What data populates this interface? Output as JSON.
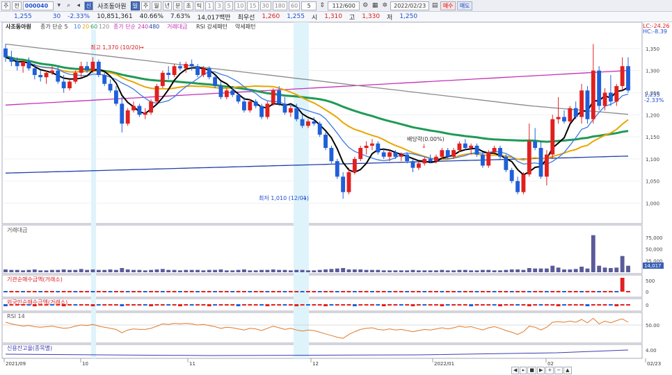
{
  "toolbar": {
    "main_menu": "주",
    "jeon": "전",
    "code": "000040",
    "name": "사조동아원",
    "credit_badge": "신",
    "chart_badge": "일",
    "periods": [
      "주",
      "월",
      "년",
      "분",
      "초",
      "틱"
    ],
    "minutes": [
      "1",
      "3",
      "5",
      "10",
      "15",
      "30",
      "180",
      "60"
    ],
    "interval": "5",
    "count": "112/600",
    "date": "2022/02/23",
    "buy_label": "매수",
    "sell_label": "매도"
  },
  "quote": {
    "price": "1,255",
    "change": "30",
    "change_pct": "-2.33%",
    "volume": "10,851,361",
    "vol_ratio": "40.66%",
    "turnover": "7.63%",
    "amount": "14,017백만",
    "best_label": "최우선",
    "best_price": "1,260",
    "best_price2": "1,255",
    "open_label": "시",
    "open": "1,310",
    "high_label": "고",
    "high": "1,330",
    "low_label": "저",
    "low": "1,250"
  },
  "legend": {
    "name": "사조동아원",
    "ma_label": "종가 단순 5",
    "ma_periods": [
      "10",
      "20",
      "60",
      "120"
    ],
    "ma2_label": "종가 단순",
    "ma2_periods": [
      "240",
      "480"
    ],
    "vol_label": "거래대금",
    "rsi_label": "RSI 강세패턴",
    "weak_label": "약세패턴",
    "lc": "LC:-24.26",
    "hc": "HC:-8.39"
  },
  "annotations": {
    "high_note": "최고 1,370 (10/20)",
    "low_note": "최저 1,010 (12/01)",
    "dividend": "배당락(0.00%)",
    "price_tag": "1,255",
    "price_tag_pct": "-2.33%",
    "vol_tag": "14,017"
  },
  "panels": {
    "volume": "거래대금",
    "inst": "기관순매수금액(거래소)",
    "foreign": "외국인순매수금액(거래소)",
    "rsi": "RSI 14",
    "credit": "신용잔고율(종목별)"
  },
  "axes": {
    "price_ticks": [
      "1,350",
      "1,300",
      "1,250",
      "1,200",
      "1,150",
      "1,100",
      "1,050",
      "1,000"
    ],
    "vol_ticks": [
      "75,000",
      "50,000",
      "25,000"
    ],
    "inst_ticks": [
      "500",
      "0"
    ],
    "foreign_ticks": [
      "0"
    ],
    "rsi_ticks": [
      "50.00"
    ],
    "credit_ticks": [
      "4.00"
    ],
    "date_ticks": [
      "2021/09",
      "10",
      "11",
      "12",
      "2022/01",
      "02",
      "02/23"
    ]
  },
  "colors": {
    "up": "#e0201f",
    "down": "#1f5fd8",
    "ma5": "#000000",
    "ma10": "#3a78e0",
    "ma20": "#e8a600",
    "ma60": "#1f9a55",
    "ma120": "#8a8a8a",
    "ma240": "#c62fb5",
    "ma480": "#1f3ea8"
  },
  "chart_data": {
    "type": "candlestick",
    "x_range": [
      "2021/09",
      "2022/02/23"
    ],
    "ylim": [
      960,
      1400
    ],
    "candles": [
      [
        1350,
        1360,
        1320,
        1330
      ],
      [
        1330,
        1345,
        1310,
        1320
      ],
      [
        1320,
        1330,
        1300,
        1310
      ],
      [
        1310,
        1325,
        1295,
        1320
      ],
      [
        1320,
        1330,
        1300,
        1305
      ],
      [
        1305,
        1315,
        1280,
        1290
      ],
      [
        1290,
        1300,
        1275,
        1285
      ],
      [
        1285,
        1300,
        1270,
        1295
      ],
      [
        1295,
        1310,
        1290,
        1300
      ],
      [
        1300,
        1310,
        1270,
        1275
      ],
      [
        1275,
        1290,
        1250,
        1260
      ],
      [
        1260,
        1280,
        1255,
        1275
      ],
      [
        1275,
        1300,
        1270,
        1295
      ],
      [
        1295,
        1320,
        1285,
        1310
      ],
      [
        1310,
        1320,
        1295,
        1300
      ],
      [
        1300,
        1330,
        1295,
        1320
      ],
      [
        1320,
        1325,
        1285,
        1290
      ],
      [
        1290,
        1295,
        1265,
        1270
      ],
      [
        1270,
        1280,
        1250,
        1255
      ],
      [
        1255,
        1265,
        1220,
        1225
      ],
      [
        1225,
        1240,
        1160,
        1180
      ],
      [
        1180,
        1215,
        1175,
        1210
      ],
      [
        1210,
        1230,
        1205,
        1220
      ],
      [
        1220,
        1225,
        1195,
        1200
      ],
      [
        1200,
        1215,
        1190,
        1205
      ],
      [
        1205,
        1235,
        1200,
        1230
      ],
      [
        1230,
        1270,
        1225,
        1265
      ],
      [
        1265,
        1300,
        1260,
        1295
      ],
      [
        1295,
        1310,
        1280,
        1290
      ],
      [
        1290,
        1315,
        1285,
        1310
      ],
      [
        1310,
        1320,
        1300,
        1305
      ],
      [
        1305,
        1320,
        1295,
        1315
      ],
      [
        1315,
        1325,
        1300,
        1310
      ],
      [
        1310,
        1315,
        1285,
        1290
      ],
      [
        1290,
        1310,
        1285,
        1305
      ],
      [
        1305,
        1310,
        1280,
        1285
      ],
      [
        1285,
        1290,
        1260,
        1265
      ],
      [
        1265,
        1275,
        1235,
        1240
      ],
      [
        1240,
        1260,
        1235,
        1255
      ],
      [
        1255,
        1265,
        1240,
        1245
      ],
      [
        1245,
        1250,
        1225,
        1230
      ],
      [
        1230,
        1240,
        1205,
        1210
      ],
      [
        1210,
        1235,
        1205,
        1230
      ],
      [
        1230,
        1235,
        1215,
        1220
      ],
      [
        1220,
        1225,
        1190,
        1195
      ],
      [
        1195,
        1230,
        1190,
        1225
      ],
      [
        1225,
        1260,
        1220,
        1255
      ],
      [
        1255,
        1265,
        1220,
        1225
      ],
      [
        1225,
        1240,
        1200,
        1205
      ],
      [
        1205,
        1220,
        1195,
        1215
      ],
      [
        1215,
        1225,
        1185,
        1190
      ],
      [
        1190,
        1200,
        1170,
        1175
      ],
      [
        1175,
        1190,
        1170,
        1185
      ],
      [
        1185,
        1195,
        1175,
        1180
      ],
      [
        1180,
        1185,
        1150,
        1155
      ],
      [
        1155,
        1160,
        1120,
        1125
      ],
      [
        1125,
        1130,
        1090,
        1095
      ],
      [
        1095,
        1100,
        1055,
        1060
      ],
      [
        1060,
        1070,
        1010,
        1025
      ],
      [
        1025,
        1080,
        1020,
        1070
      ],
      [
        1070,
        1105,
        1065,
        1100
      ],
      [
        1100,
        1130,
        1095,
        1125
      ],
      [
        1125,
        1140,
        1110,
        1130
      ],
      [
        1130,
        1145,
        1120,
        1135
      ],
      [
        1135,
        1140,
        1110,
        1115
      ],
      [
        1115,
        1125,
        1100,
        1105
      ],
      [
        1105,
        1120,
        1095,
        1115
      ],
      [
        1115,
        1120,
        1100,
        1105
      ],
      [
        1105,
        1115,
        1095,
        1110
      ],
      [
        1110,
        1115,
        1090,
        1095
      ],
      [
        1095,
        1100,
        1070,
        1080
      ],
      [
        1080,
        1095,
        1075,
        1090
      ],
      [
        1090,
        1105,
        1085,
        1100
      ],
      [
        1100,
        1110,
        1090,
        1095
      ],
      [
        1095,
        1110,
        1090,
        1105
      ],
      [
        1105,
        1125,
        1100,
        1120
      ],
      [
        1120,
        1125,
        1100,
        1105
      ],
      [
        1105,
        1125,
        1100,
        1120
      ],
      [
        1120,
        1140,
        1115,
        1135
      ],
      [
        1135,
        1145,
        1120,
        1125
      ],
      [
        1125,
        1135,
        1110,
        1130
      ],
      [
        1130,
        1135,
        1105,
        1110
      ],
      [
        1110,
        1115,
        1080,
        1085
      ],
      [
        1085,
        1120,
        1080,
        1115
      ],
      [
        1115,
        1130,
        1110,
        1125
      ],
      [
        1125,
        1130,
        1100,
        1105
      ],
      [
        1105,
        1110,
        1070,
        1075
      ],
      [
        1075,
        1080,
        1045,
        1050
      ],
      [
        1050,
        1060,
        1020,
        1025
      ],
      [
        1025,
        1070,
        1020,
        1065
      ],
      [
        1065,
        1180,
        1060,
        1140
      ],
      [
        1140,
        1170,
        1120,
        1125
      ],
      [
        1125,
        1140,
        1055,
        1060
      ],
      [
        1060,
        1120,
        1040,
        1110
      ],
      [
        1110,
        1200,
        1100,
        1190
      ],
      [
        1190,
        1240,
        1180,
        1195
      ],
      [
        1195,
        1210,
        1180,
        1185
      ],
      [
        1185,
        1220,
        1180,
        1215
      ],
      [
        1215,
        1230,
        1190,
        1195
      ],
      [
        1195,
        1270,
        1180,
        1255
      ],
      [
        1255,
        1265,
        1180,
        1190
      ],
      [
        1190,
        1360,
        1180,
        1300
      ],
      [
        1300,
        1310,
        1210,
        1220
      ],
      [
        1220,
        1260,
        1210,
        1250
      ],
      [
        1250,
        1290,
        1220,
        1230
      ],
      [
        1230,
        1270,
        1220,
        1265
      ],
      [
        1265,
        1330,
        1255,
        1310
      ],
      [
        1310,
        1330,
        1250,
        1255
      ]
    ],
    "volume": [
      6,
      5,
      5,
      4,
      5,
      6,
      4,
      4,
      5,
      5,
      6,
      5,
      5,
      7,
      5,
      6,
      5,
      5,
      6,
      5,
      9,
      6,
      5,
      5,
      4,
      5,
      6,
      7,
      5,
      5,
      4,
      5,
      5,
      5,
      4,
      5,
      5,
      6,
      4,
      4,
      5,
      6,
      4,
      4,
      5,
      5,
      6,
      5,
      5,
      4,
      5,
      5,
      4,
      4,
      5,
      6,
      7,
      8,
      9,
      6,
      6,
      6,
      5,
      5,
      5,
      4,
      4,
      4,
      4,
      4,
      5,
      4,
      4,
      4,
      4,
      5,
      4,
      4,
      5,
      5,
      4,
      4,
      5,
      5,
      4,
      4,
      5,
      6,
      6,
      5,
      9,
      8,
      8,
      8,
      14,
      10,
      6,
      6,
      7,
      12,
      8,
      80,
      14,
      10,
      9,
      10,
      35,
      14
    ],
    "inst": [
      0,
      0,
      0,
      0,
      0,
      0,
      0,
      0,
      0,
      0,
      0,
      0,
      0,
      0,
      0,
      0,
      0,
      0,
      0,
      0,
      0,
      0,
      0,
      0,
      0,
      0,
      0,
      0,
      0,
      0,
      0,
      0,
      0,
      0,
      0,
      0,
      0,
      0,
      0,
      0,
      0,
      0,
      0,
      0,
      0,
      0,
      0,
      0,
      0,
      0,
      0,
      0,
      0,
      0,
      0,
      0,
      0,
      0,
      0,
      0,
      0,
      0,
      0,
      0,
      0,
      0,
      0,
      0,
      0,
      0,
      0,
      0,
      0,
      0,
      0,
      0,
      0,
      0,
      0,
      0,
      0,
      0,
      0,
      0,
      0,
      0,
      0,
      0,
      0,
      0,
      0,
      0,
      0,
      0,
      0,
      0,
      0,
      0,
      0,
      0,
      0,
      0,
      0,
      0,
      0,
      0,
      700,
      0
    ],
    "rsi": [
      55,
      52,
      50,
      48,
      49,
      47,
      46,
      47,
      48,
      46,
      44,
      45,
      48,
      50,
      49,
      51,
      48,
      46,
      44,
      42,
      36,
      41,
      43,
      42,
      42,
      44,
      48,
      52,
      51,
      53,
      52,
      53,
      52,
      50,
      51,
      49,
      47,
      44,
      46,
      45,
      43,
      41,
      44,
      43,
      40,
      44,
      48,
      45,
      42,
      44,
      41,
      39,
      41,
      40,
      37,
      34,
      31,
      28,
      26,
      33,
      38,
      42,
      44,
      45,
      42,
      41,
      43,
      41,
      42,
      40,
      38,
      40,
      42,
      41,
      43,
      45,
      43,
      45,
      48,
      46,
      47,
      44,
      41,
      45,
      47,
      44,
      40,
      37,
      33,
      38,
      48,
      46,
      41,
      46,
      55,
      56,
      55,
      57,
      55,
      60,
      54,
      62,
      52,
      57,
      54,
      58,
      61,
      55
    ]
  }
}
